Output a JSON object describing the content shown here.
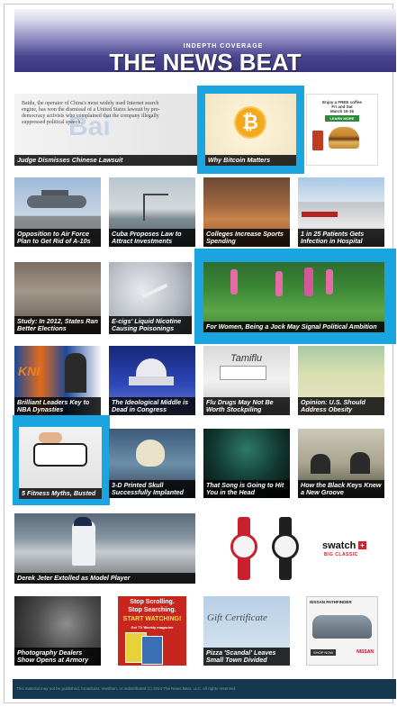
{
  "header": {
    "kicker": "INDEPTH COVERAGE",
    "title": "THE NEWS BEAT"
  },
  "lead_story": {
    "excerpt": "Baidu, the operator of China's most widely used Internet search engine, has won the dismissal of a United States lawsuit by pro-democracy activists who complained that the company illegally suppressed political speech."
  },
  "tiles": [
    {
      "caption": "Judge Dismisses Chinese Lawsuit"
    },
    {
      "caption": "Why Bitcoin Matters"
    },
    {
      "caption": "Opposition to Air Force Plan to Get Rid of A-10s"
    },
    {
      "caption": "Cuba Proposes Law to Attract Investments"
    },
    {
      "caption": "Colleges Increase Sports Spending"
    },
    {
      "caption": "1 in 25 Patients Gets Infection in Hospital"
    },
    {
      "caption": "Study: In 2012, States Ran Better Elections"
    },
    {
      "caption": "E-cigs' Liquid Nicotine Causing Poisonings"
    },
    {
      "caption": "For Women, Being a Jock May Signal Political Ambition"
    },
    {
      "caption": "Brilliant Leaders Key to NBA Dynasties"
    },
    {
      "caption": "The Ideological Middle is Dead in Congress"
    },
    {
      "caption": "Flu Drugs May Not Be Worth Stockpiling"
    },
    {
      "caption": "Opinion: U.S. Should Address Obesity"
    },
    {
      "caption": "5 Fitness Myths, Busted"
    },
    {
      "caption": "3-D Printed Skull Successfully Implanted"
    },
    {
      "caption": "That Song is Going to Hit You in the Head"
    },
    {
      "caption": "How the Black Keys Knew a New Groove"
    },
    {
      "caption": "Derek Jeter Extolled as Model Player"
    },
    {
      "caption": "Photography Dealers Show Opens at Armory"
    },
    {
      "caption": "Pizza 'Scandal' Leaves Small Town Divided"
    }
  ],
  "ads": {
    "burger": {
      "line1": "Enjoy a FREE coffee",
      "line2": "Fri and Sat",
      "line3": "March 15-16",
      "button": "LEARN MORE"
    },
    "swatch": {
      "brand": "swatch",
      "sub": "BIG CLASSIC"
    },
    "tv": {
      "line1": "Stop Scrolling.",
      "line2": "Stop Searching.",
      "line3": "START WATCHING!",
      "line4": "Get TV Weekly magazine"
    },
    "gift": {
      "text": "Gift Certificate"
    },
    "nissan": {
      "title": "NISSAN PATHFINDER",
      "button": "SHOP NOW",
      "brand": "NISSAN"
    }
  },
  "footer": {
    "text": "This material may not be published, broadcast, rewritten, or redistributed (c) 2014 The News Beat, LLC. All rights reserved."
  },
  "colors": {
    "highlight": "#1ba5e0",
    "caption_bg": "#000000",
    "footer_bg": "#15374f"
  }
}
